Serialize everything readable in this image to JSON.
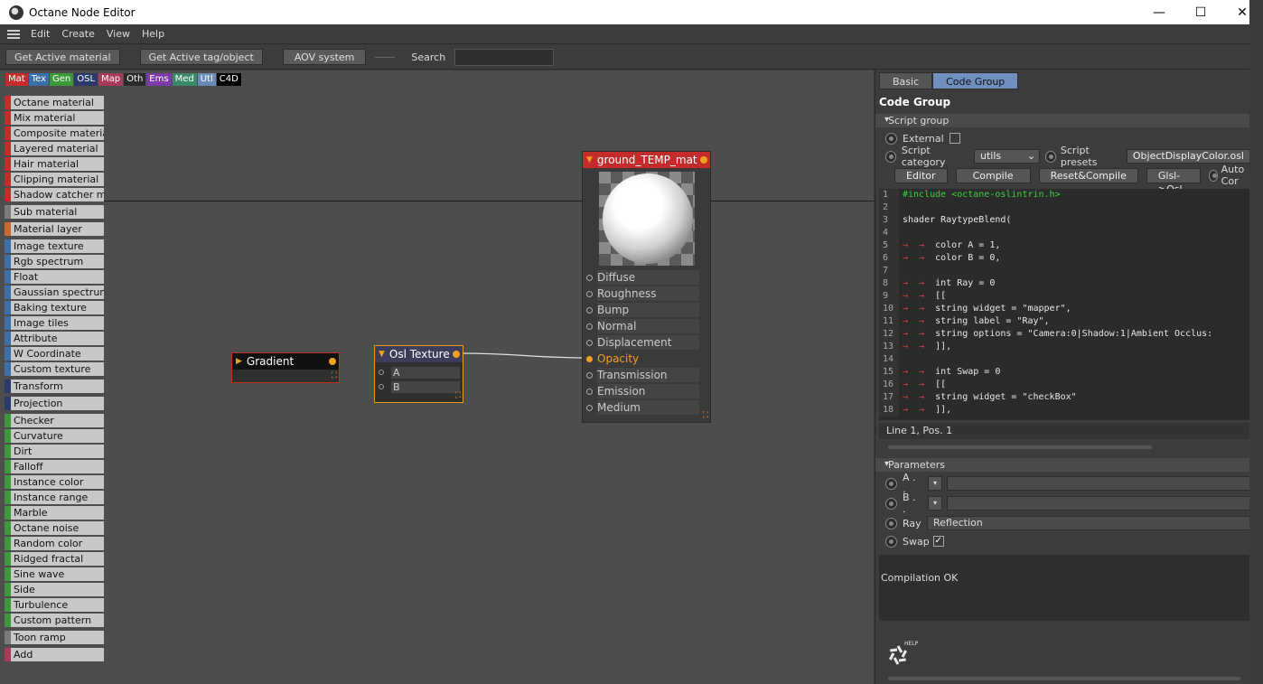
{
  "window": {
    "title": "Octane Node Editor",
    "minimize": "—",
    "maximize": "☐",
    "close": "✕"
  },
  "menu": [
    "Edit",
    "Create",
    "View",
    "Help"
  ],
  "toolbar": {
    "get_active_material": "Get Active material",
    "get_active_tag": "Get Active tag/object",
    "aov_system": "AOV system",
    "search_label": "Search",
    "search_value": ""
  },
  "categories": [
    {
      "label": "Mat",
      "color": "#c42b2b"
    },
    {
      "label": "Tex",
      "color": "#3a6fa8"
    },
    {
      "label": "Gen",
      "color": "#3a9a3a"
    },
    {
      "label": "OSL",
      "color": "#2b3a6a"
    },
    {
      "label": "Map",
      "color": "#a83a5a"
    },
    {
      "label": "Oth",
      "color": "#2a2a2a"
    },
    {
      "label": "Ems",
      "color": "#7a3aa8"
    },
    {
      "label": "Med",
      "color": "#3a8a6a"
    },
    {
      "label": "Utl",
      "color": "#6a8ab8"
    },
    {
      "label": "C4D",
      "color": "#000000"
    }
  ],
  "node_list": [
    {
      "label": "Octane material",
      "color": "#c42b2b"
    },
    {
      "label": "Mix material",
      "color": "#c42b2b"
    },
    {
      "label": "Composite material",
      "color": "#c42b2b"
    },
    {
      "label": "Layered material",
      "color": "#c42b2b"
    },
    {
      "label": "Hair material",
      "color": "#c42b2b"
    },
    {
      "label": "Clipping material",
      "color": "#c42b2b"
    },
    {
      "label": "Shadow catcher ma",
      "color": "#c42b2b"
    },
    {
      "label": "Sub material",
      "color": "#7a7a7a",
      "gap": true
    },
    {
      "label": "Material layer",
      "color": "#c86a2a",
      "gap": true
    },
    {
      "label": "Image texture",
      "color": "#3a6fa8",
      "gap": true
    },
    {
      "label": "Rgb spectrum",
      "color": "#3a6fa8"
    },
    {
      "label": "Float",
      "color": "#3a6fa8"
    },
    {
      "label": "Gaussian spectrum",
      "color": "#3a6fa8"
    },
    {
      "label": "Baking texture",
      "color": "#3a6fa8"
    },
    {
      "label": "Image tiles",
      "color": "#3a6fa8"
    },
    {
      "label": "Attribute",
      "color": "#3a6fa8"
    },
    {
      "label": "W Coordinate",
      "color": "#3a6fa8"
    },
    {
      "label": "Custom texture",
      "color": "#3a6fa8"
    },
    {
      "label": "Transform",
      "color": "#2b3a6a",
      "gap": true
    },
    {
      "label": "Projection",
      "color": "#2b3a6a",
      "gap": true
    },
    {
      "label": "Checker",
      "color": "#3a9a3a",
      "gap": true
    },
    {
      "label": "Curvature",
      "color": "#3a9a3a"
    },
    {
      "label": "Dirt",
      "color": "#3a9a3a"
    },
    {
      "label": "Falloff",
      "color": "#3a9a3a"
    },
    {
      "label": "Instance color",
      "color": "#3a9a3a"
    },
    {
      "label": "Instance range",
      "color": "#3a9a3a"
    },
    {
      "label": "Marble",
      "color": "#3a9a3a"
    },
    {
      "label": "Octane noise",
      "color": "#3a9a3a"
    },
    {
      "label": "Random color",
      "color": "#3a9a3a"
    },
    {
      "label": "Ridged fractal",
      "color": "#3a9a3a"
    },
    {
      "label": "Sine wave",
      "color": "#3a9a3a"
    },
    {
      "label": "Side",
      "color": "#3a9a3a"
    },
    {
      "label": "Turbulence",
      "color": "#3a9a3a"
    },
    {
      "label": "Custom pattern",
      "color": "#3a9a3a"
    },
    {
      "label": "Toon ramp",
      "color": "#7a7a7a",
      "gap": true
    },
    {
      "label": "Add",
      "color": "#a83a5a",
      "gap": true
    }
  ],
  "nodes": {
    "gradient": {
      "title": "Gradient"
    },
    "osl": {
      "title": "Osl Texture",
      "pins": [
        "A",
        "B"
      ]
    },
    "material": {
      "title": "ground_TEMP_mat",
      "pins": [
        "Diffuse",
        "Roughness",
        "Bump",
        "Normal",
        "Displacement",
        "Opacity",
        "Transmission",
        "Emission",
        "Medium"
      ],
      "active_pin": "Opacity"
    }
  },
  "panel": {
    "tabs": [
      "Basic",
      "Code Group"
    ],
    "active_tab": "Code Group",
    "title": "Code Group",
    "script_group": "Script group",
    "external_label": "External",
    "script_category_label": "Script category",
    "script_category_value": "utils",
    "script_presets_label": "Script presets",
    "script_presets_value": "ObjectDisplayColor.osl",
    "buttons": {
      "editor": "Editor",
      "compile": "Compile",
      "reset_compile": "Reset&Compile",
      "glsl_osl": "Glsl->Osl",
      "auto_compile": "Auto Cor"
    },
    "code": [
      "#include <octane-oslintrin.h>",
      "",
      "shader RaytypeBlend(",
      "",
      "color A = 1,",
      "color B = 0,",
      "",
      "int Ray = 0",
      "[[",
      "string widget = \"mapper\",",
      "string label = \"Ray\",",
      "string options = \"Camera:0|Shadow:1|Ambient Occlus:",
      "]],",
      "",
      "int Swap = 0",
      "[[",
      "string widget = \"checkBox\"",
      "]],"
    ],
    "status": "Line 1, Pos. 1",
    "parameters_label": "Parameters",
    "params": [
      {
        "label": "A . .",
        "value": ""
      },
      {
        "label": "B . .",
        "value": ""
      },
      {
        "label": "Ray",
        "value": "Reflection"
      },
      {
        "label": "Swap",
        "value": "✓"
      }
    ],
    "compile_status": "Compilation OK",
    "help_label": "HELP"
  }
}
